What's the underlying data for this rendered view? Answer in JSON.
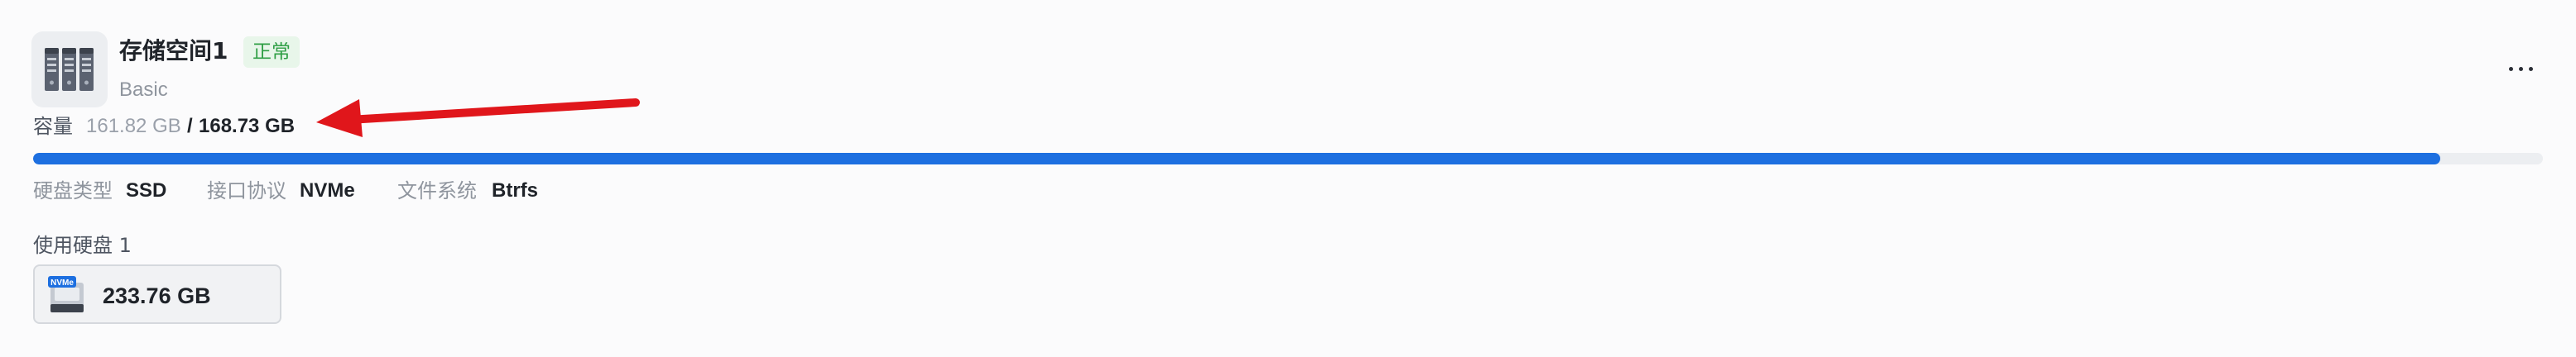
{
  "pool": {
    "name": "存储空间1",
    "status": "正常",
    "type": "Basic",
    "more_label": "更多操作"
  },
  "capacity": {
    "label": "容量",
    "used": "161.82 GB",
    "separator": "/",
    "total": "168.73 GB",
    "usage_fraction": 0.959
  },
  "specs": {
    "disk_type_label": "硬盘类型",
    "disk_type_value": "SSD",
    "interface_label": "接口协议",
    "interface_value": "NVMe",
    "filesystem_label": "文件系统",
    "filesystem_value": "Btrfs"
  },
  "disks": {
    "label": "使用硬盘 1",
    "items": [
      {
        "size": "233.76 GB",
        "badge": "NVMe"
      }
    ]
  },
  "colors": {
    "accent": "#1d6fe0",
    "status_green": "#2e9e44",
    "arrow_red": "#e0161b"
  },
  "icons": {
    "pool": "storage-pool-icon",
    "disk": "nvme-ssd-icon",
    "more": "more-horizontal-icon"
  }
}
